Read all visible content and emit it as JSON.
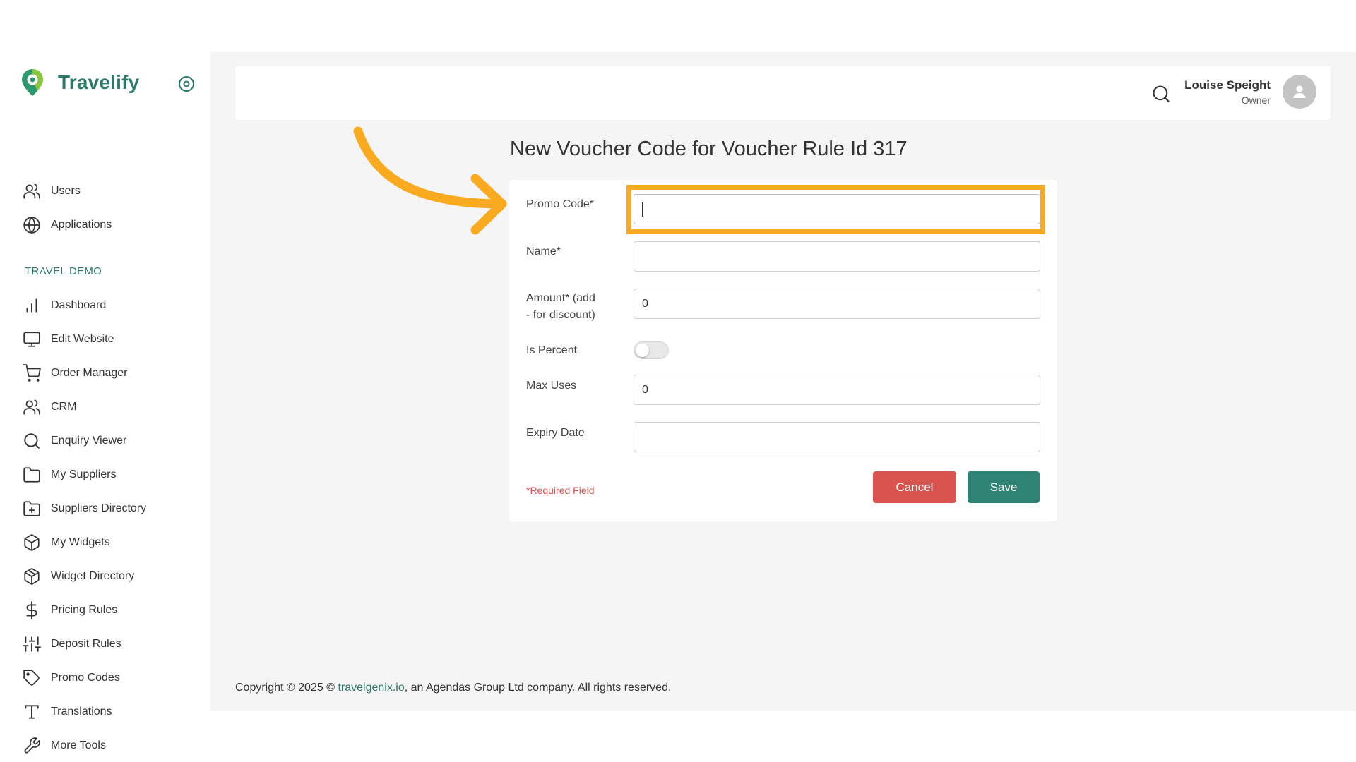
{
  "brand": {
    "name": "Travelify"
  },
  "sidebar": {
    "top_items": [
      {
        "label": "Users",
        "icon": "users-icon"
      },
      {
        "label": "Applications",
        "icon": "globe-icon"
      }
    ],
    "section_label": "TRAVEL DEMO",
    "items": [
      {
        "label": "Dashboard",
        "icon": "bar-chart-icon"
      },
      {
        "label": "Edit Website",
        "icon": "monitor-icon"
      },
      {
        "label": "Order Manager",
        "icon": "cart-icon"
      },
      {
        "label": "CRM",
        "icon": "users-icon"
      },
      {
        "label": "Enquiry Viewer",
        "icon": "search-icon"
      },
      {
        "label": "My Suppliers",
        "icon": "folder-icon"
      },
      {
        "label": "Suppliers Directory",
        "icon": "folder-plus-icon"
      },
      {
        "label": "My Widgets",
        "icon": "box-icon"
      },
      {
        "label": "Widget Directory",
        "icon": "package-icon"
      },
      {
        "label": "Pricing Rules",
        "icon": "dollar-icon"
      },
      {
        "label": "Deposit Rules",
        "icon": "sliders-icon"
      },
      {
        "label": "Promo Codes",
        "icon": "tag-icon"
      },
      {
        "label": "Translations",
        "icon": "type-icon"
      },
      {
        "label": "More Tools",
        "icon": "wrench-icon"
      }
    ]
  },
  "header": {
    "user_name": "Louise Speight",
    "user_role": "Owner"
  },
  "page": {
    "title": "New Voucher Code for Voucher Rule Id 317"
  },
  "form": {
    "promo_code": {
      "label": "Promo Code*",
      "value": ""
    },
    "name": {
      "label": "Name*",
      "value": ""
    },
    "amount": {
      "label_line1": "Amount* (add",
      "label_line2": "- for discount)",
      "value": "0"
    },
    "is_percent": {
      "label": "Is Percent",
      "checked": false
    },
    "max_uses": {
      "label": "Max Uses",
      "value": "0"
    },
    "expiry_date": {
      "label": "Expiry Date",
      "value": ""
    },
    "required_note": "*Required Field",
    "cancel_label": "Cancel",
    "save_label": "Save"
  },
  "footer": {
    "prefix": "Copyright © 2025 © ",
    "link": "travelgenix.io",
    "suffix": ", an Agendas Group Ltd company. All rights reserved."
  },
  "colors": {
    "brand": "#2c7a6b",
    "save": "#2f8374",
    "cancel": "#d9534f",
    "highlight": "#f9aa1e"
  }
}
